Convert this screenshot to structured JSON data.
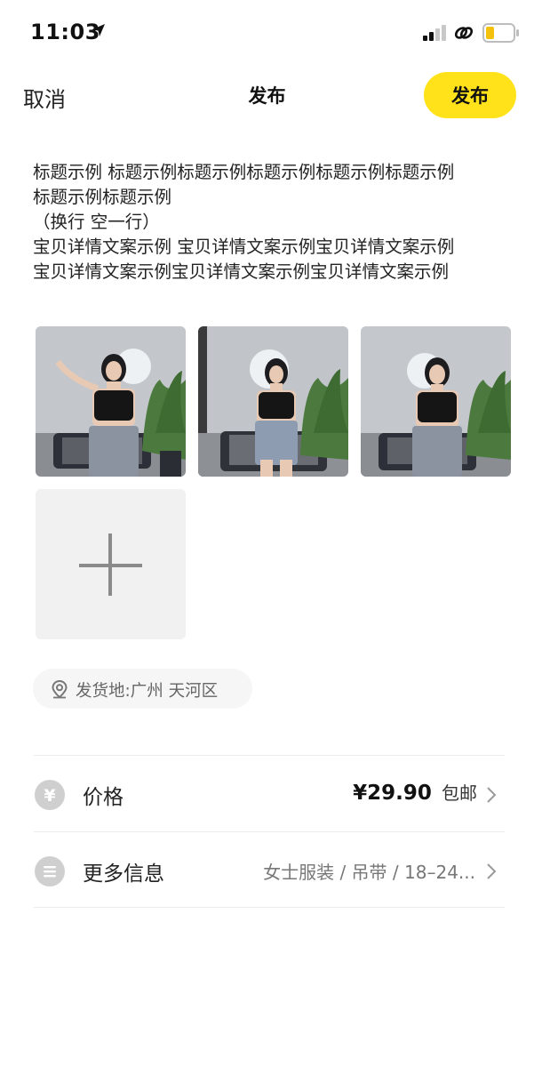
{
  "status_bar": {
    "time": "11:03"
  },
  "nav": {
    "cancel_label": "取消",
    "title": "发布",
    "publish_label": "发布",
    "accent_color": "#ffe21a"
  },
  "description": {
    "lines": [
      "标题示例 标题示例标题示例标题示例标题示例标题示例",
      "标题示例标题示例",
      "（换行 空一行）",
      "宝贝详情文案示例 宝贝详情文案示例宝贝详情文案示例",
      "宝贝详情文案示例宝贝详情文案示例宝贝详情文案示例"
    ]
  },
  "photos": {
    "count": 3,
    "add_icon": "plus-icon"
  },
  "location": {
    "icon": "location-pin-icon",
    "text": "发货地:广州 天河区"
  },
  "price_row": {
    "icon": "yen-icon",
    "icon_glyph": "¥",
    "label": "价格",
    "value": "¥29.90",
    "shipping": "包邮"
  },
  "more_row": {
    "icon": "list-icon",
    "label": "更多信息",
    "value": "女士服装 / 吊带 / 18–24..."
  }
}
